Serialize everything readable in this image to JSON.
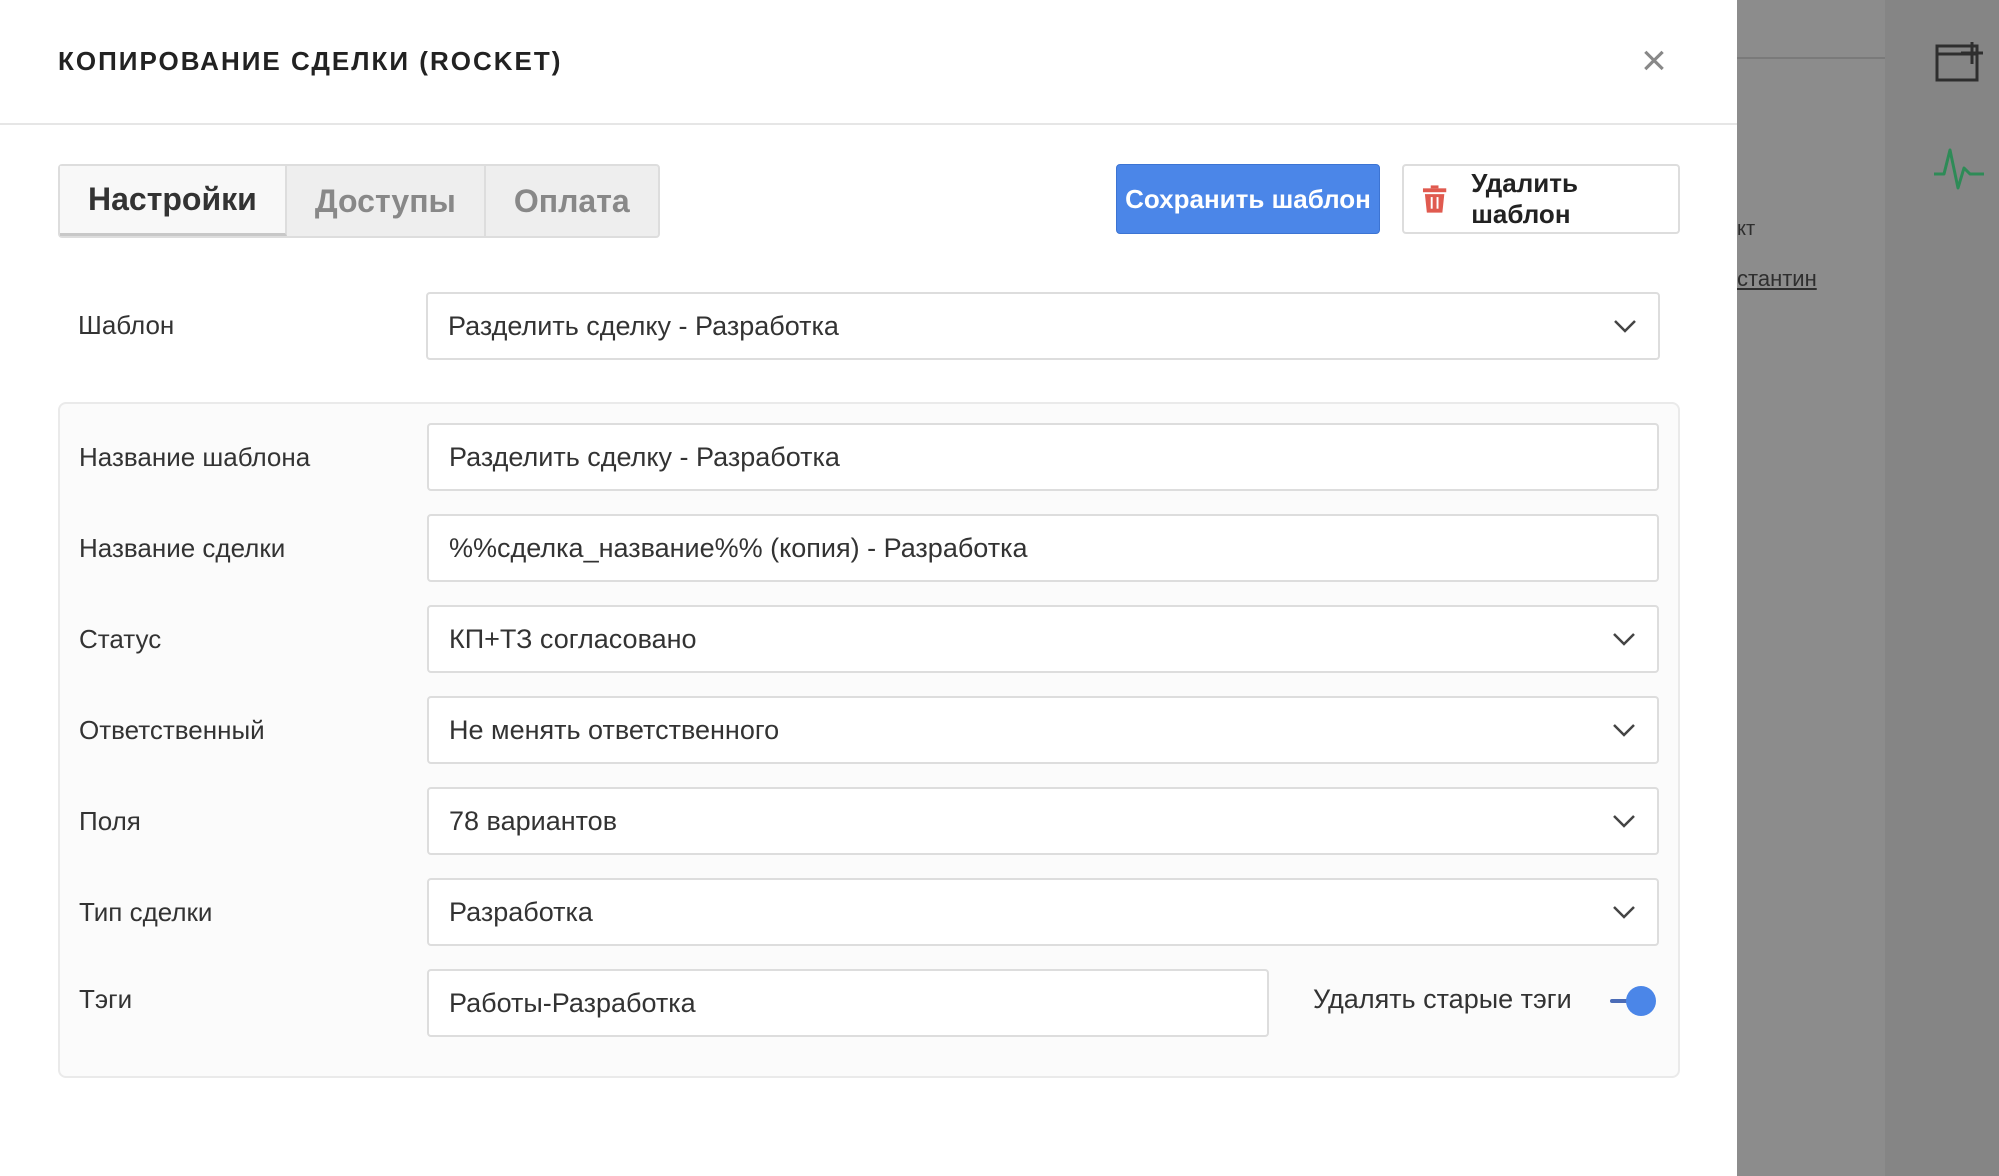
{
  "modal": {
    "title": "КОПИРОВАНИЕ СДЕЛКИ (ROCKET)",
    "close_symbol": "×"
  },
  "tabs": [
    {
      "label": "Настройки",
      "active": true
    },
    {
      "label": "Доступы",
      "active": false
    },
    {
      "label": "Оплата",
      "active": false
    }
  ],
  "actions": {
    "save_label": "Сохранить шаблон",
    "delete_label": "Удалить шаблон"
  },
  "template": {
    "label": "Шаблон",
    "value": "Разделить сделку - Разработка"
  },
  "form": {
    "template_name": {
      "label": "Название шаблона",
      "value": "Разделить сделку - Разработка"
    },
    "deal_name": {
      "label": "Название сделки",
      "value": "%%сделка_название%% (копия) - Разработка"
    },
    "status": {
      "label": "Статус",
      "value": "КП+ТЗ согласовано"
    },
    "responsible": {
      "label": "Ответственный",
      "value": "Не менять ответственного"
    },
    "fields": {
      "label": "Поля",
      "value": "78 вариантов"
    },
    "deal_type": {
      "label": "Тип сделки",
      "value": "Разработка"
    },
    "tags": {
      "label": "Тэги",
      "value": "Работы-Разработка"
    },
    "delete_old_tags": {
      "label": "Удалять старые тэги",
      "enabled": true
    }
  },
  "background": {
    "text1": "кт",
    "text2": "стантин"
  },
  "colors": {
    "accent": "#4b86e8",
    "trash": "#e05a4f",
    "pulse": "#2e8b57"
  },
  "icons": [
    "close-icon",
    "trash-icon",
    "chevron-down-icon",
    "add-window-icon",
    "pulse-icon"
  ]
}
